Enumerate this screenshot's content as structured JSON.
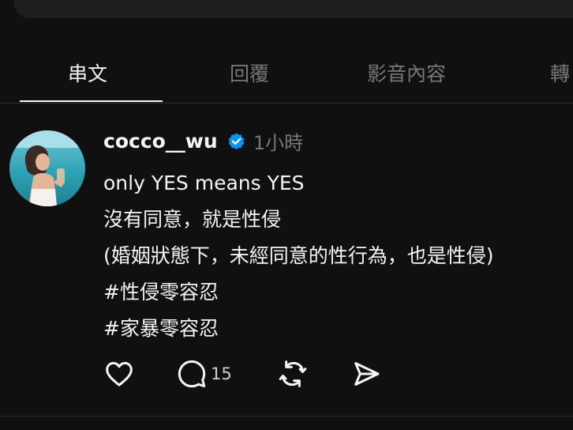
{
  "tabs": [
    {
      "label": "串文",
      "active": true
    },
    {
      "label": "回覆",
      "active": false
    },
    {
      "label": "影音內容",
      "active": false
    },
    {
      "label": "轉",
      "active": false
    }
  ],
  "post": {
    "username": "cocco__wu",
    "verified": true,
    "time": "1小時",
    "lines": [
      "only YES means YES",
      "沒有同意，就是性侵",
      "(婚姻狀態下，未經同意的性行為，也是性侵)",
      "#性侵零容忍",
      "#家暴零容忍"
    ],
    "actions": {
      "like_icon": "heart-icon",
      "comment_icon": "comment-icon",
      "comment_count": "15",
      "repost_icon": "repost-icon",
      "share_icon": "send-icon"
    }
  },
  "colors": {
    "background": "#101010",
    "text": "#f3f5f7",
    "muted": "#777777",
    "verified": "#0095f6",
    "divider": "#2d2d2d"
  }
}
